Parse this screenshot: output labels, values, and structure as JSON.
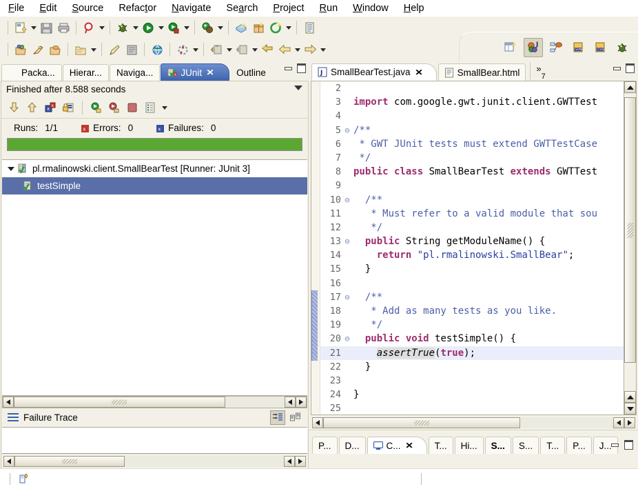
{
  "menubar": {
    "items": [
      {
        "label": "File",
        "accel": "F"
      },
      {
        "label": "Edit",
        "accel": "E"
      },
      {
        "label": "Source",
        "accel": "S"
      },
      {
        "label": "Refactor",
        "accel": "t"
      },
      {
        "label": "Navigate",
        "accel": "N"
      },
      {
        "label": "Search",
        "accel": "a"
      },
      {
        "label": "Project",
        "accel": "P"
      },
      {
        "label": "Run",
        "accel": "R"
      },
      {
        "label": "Window",
        "accel": "W"
      },
      {
        "label": "Help",
        "accel": "H"
      }
    ]
  },
  "toolbar": {
    "row1": [
      {
        "name": "new-wizard",
        "icon": "new-file-icon",
        "dropdown": true
      },
      {
        "name": "save",
        "icon": "save-icon",
        "dropdown": false
      },
      {
        "name": "print",
        "icon": "print-icon",
        "dropdown": false
      },
      {
        "name": "search",
        "icon": "search-icon",
        "dropdown": true
      },
      {
        "name": "debug",
        "icon": "debug-bug-icon",
        "dropdown": true
      },
      {
        "name": "run",
        "icon": "run-play-icon",
        "dropdown": true
      },
      {
        "name": "run-external",
        "icon": "run-external-icon",
        "dropdown": true
      },
      {
        "name": "profile",
        "icon": "profile-icon",
        "dropdown": true
      },
      {
        "name": "new-gwt-module",
        "icon": "gwt-module-icon",
        "dropdown": false
      },
      {
        "name": "new-package",
        "icon": "package-icon",
        "dropdown": false
      },
      {
        "name": "gwt-compile",
        "icon": "gwt-compile-icon",
        "dropdown": true
      },
      {
        "name": "open-task",
        "icon": "task-list-icon",
        "dropdown": false
      }
    ],
    "row2": [
      {
        "name": "open-type",
        "icon": "open-type-icon",
        "dropdown": false
      },
      {
        "name": "new-java-class",
        "icon": "java-class-icon",
        "dropdown": false
      },
      {
        "name": "open-resource",
        "icon": "open-resource-icon",
        "dropdown": false
      },
      {
        "name": "new-folder",
        "icon": "new-folder-icon",
        "dropdown": true
      },
      {
        "name": "external-tools",
        "icon": "pencil-icon",
        "dropdown": false
      },
      {
        "name": "toggle-markers",
        "icon": "markers-icon",
        "dropdown": false
      },
      {
        "name": "open-browser",
        "icon": "globe-icon",
        "dropdown": false
      },
      {
        "name": "last-edit",
        "icon": "history-icon",
        "dropdown": true
      },
      {
        "name": "next-annotation",
        "icon": "next-annotation-icon",
        "dropdown": true
      },
      {
        "name": "prev-annotation",
        "icon": "prev-annotation-icon",
        "dropdown": true
      },
      {
        "name": "back-to-edit",
        "icon": "back-edit-icon",
        "dropdown": false
      },
      {
        "name": "back",
        "icon": "back-arrow-icon",
        "dropdown": true
      },
      {
        "name": "forward",
        "icon": "forward-arrow-icon",
        "dropdown": true
      }
    ]
  },
  "perspectives": [
    {
      "name": "open-perspective",
      "icon": "open-perspective-icon",
      "active": false
    },
    {
      "name": "java-perspective",
      "icon": "java-perspective-icon",
      "active": true
    },
    {
      "name": "java-browsing-perspective",
      "icon": "java-browsing-icon",
      "active": false
    },
    {
      "name": "svn-perspective",
      "icon": "svn-repo-icon",
      "active": false
    },
    {
      "name": "cvs-perspective",
      "icon": "cvs-repo-icon",
      "active": false
    },
    {
      "name": "debug-perspective",
      "icon": "debug-perspective-icon",
      "active": false
    }
  ],
  "left_view": {
    "tabs": [
      {
        "label": "Packa...",
        "icon": "package-explorer-icon",
        "active": false,
        "closeable": false
      },
      {
        "label": "Hierar...",
        "icon": "hierarchy-icon",
        "active": false,
        "closeable": false
      },
      {
        "label": "Naviga...",
        "icon": "navigator-icon",
        "active": false,
        "closeable": false
      },
      {
        "label": "JUnit",
        "icon": "junit-icon",
        "active": true,
        "closeable": true
      },
      {
        "label": "Outline",
        "icon": "outline-icon",
        "active": false,
        "closeable": false
      }
    ],
    "minimize_label": "Minimize",
    "maximize_label": "Maximize",
    "junit": {
      "status": "Finished after 8.588 seconds",
      "toolbar": [
        {
          "name": "next-failure",
          "icon": "arrow-down-icon"
        },
        {
          "name": "previous-failure",
          "icon": "arrow-up-icon"
        },
        {
          "name": "show-failures-only",
          "icon": "failures-only-icon"
        },
        {
          "name": "lock-scroll",
          "icon": "lock-icon"
        },
        {
          "name": "rerun-test",
          "icon": "rerun-icon"
        },
        {
          "name": "rerun-failed-tests",
          "icon": "rerun-failed-icon"
        },
        {
          "name": "stop-test-run",
          "icon": "stop-icon"
        },
        {
          "name": "test-run-history",
          "icon": "history-list-icon"
        }
      ],
      "counters": {
        "runs_label": "Runs:",
        "runs_value": "1/1",
        "errors_label": "Errors:",
        "errors_value": "0",
        "failures_label": "Failures:",
        "failures_value": "0"
      },
      "progress": {
        "percent": 100,
        "color": "#5aa832"
      },
      "tree": [
        {
          "label": "pl.rmalinowski.client.SmallBearTest [Runner: JUnit 3]",
          "icon": "test-suite-icon",
          "expanded": true,
          "selected": false,
          "indent": 0
        },
        {
          "label": "testSimple",
          "icon": "test-method-icon",
          "expanded": false,
          "selected": true,
          "indent": 1
        }
      ],
      "failure_trace": {
        "title": "Failure Trace",
        "icon": "stack-trace-icon",
        "buttons": [
          {
            "name": "filter-stack-trace",
            "icon": "filter-icon",
            "pressed": true
          },
          {
            "name": "compare-result",
            "icon": "compare-icon",
            "pressed": false
          }
        ],
        "content": ""
      }
    }
  },
  "editor": {
    "tabs": [
      {
        "label": "SmallBearTest.java",
        "icon": "java-file-icon",
        "active": true,
        "closeable": true
      },
      {
        "label": "SmallBear.html",
        "icon": "html-file-icon",
        "active": false,
        "closeable": false
      }
    ],
    "overflow_label": "»",
    "overflow_count": "7",
    "minimize_label": "Minimize",
    "maximize_label": "Maximize",
    "code_lines": [
      {
        "num": "2",
        "fold": "",
        "marker": "",
        "tokens": [],
        "highlight": false,
        "changed": false
      },
      {
        "num": "3",
        "fold": "",
        "marker": "",
        "highlight": false,
        "changed": false,
        "tokens": [
          {
            "t": "import ",
            "c": "kw"
          },
          {
            "t": "com.google.gwt.junit.client.GWTTest",
            "c": "plain"
          }
        ]
      },
      {
        "num": "4",
        "fold": "",
        "marker": "",
        "tokens": [],
        "highlight": false,
        "changed": false
      },
      {
        "num": "5",
        "fold": "⊖",
        "marker": "",
        "highlight": false,
        "changed": false,
        "tokens": [
          {
            "t": "/**",
            "c": "cmt"
          }
        ]
      },
      {
        "num": "6",
        "fold": "",
        "marker": "",
        "highlight": false,
        "changed": false,
        "tokens": [
          {
            "t": " * GWT JUnit tests must extend GWTTestCase",
            "c": "cmt"
          }
        ]
      },
      {
        "num": "7",
        "fold": "",
        "marker": "",
        "highlight": false,
        "changed": false,
        "tokens": [
          {
            "t": " */",
            "c": "cmt"
          }
        ]
      },
      {
        "num": "8",
        "fold": "",
        "marker": "",
        "highlight": false,
        "changed": false,
        "tokens": [
          {
            "t": "public class ",
            "c": "kw"
          },
          {
            "t": "SmallBearTest ",
            "c": "plain"
          },
          {
            "t": "extends ",
            "c": "kw"
          },
          {
            "t": "GWTTest",
            "c": "plain"
          }
        ]
      },
      {
        "num": "9",
        "fold": "",
        "marker": "",
        "tokens": [],
        "highlight": false,
        "changed": false
      },
      {
        "num": "10",
        "fold": "⊖",
        "marker": "",
        "highlight": false,
        "changed": false,
        "tokens": [
          {
            "t": "  /**",
            "c": "cmt"
          }
        ]
      },
      {
        "num": "11",
        "fold": "",
        "marker": "",
        "highlight": false,
        "changed": false,
        "tokens": [
          {
            "t": "   * Must refer to a valid module that sou",
            "c": "cmt"
          }
        ]
      },
      {
        "num": "12",
        "fold": "",
        "marker": "",
        "highlight": false,
        "changed": false,
        "tokens": [
          {
            "t": "   */",
            "c": "cmt"
          }
        ]
      },
      {
        "num": "13",
        "fold": "⊖",
        "marker": "override",
        "highlight": false,
        "changed": false,
        "tokens": [
          {
            "t": "  public ",
            "c": "kw"
          },
          {
            "t": "String getModuleName() {",
            "c": "plain"
          }
        ]
      },
      {
        "num": "14",
        "fold": "",
        "marker": "",
        "highlight": false,
        "changed": false,
        "tokens": [
          {
            "t": "    ",
            "c": "plain"
          },
          {
            "t": "return ",
            "c": "kw"
          },
          {
            "t": "\"pl.rmalinowski.SmallBear\"",
            "c": "str"
          },
          {
            "t": ";",
            "c": "plain"
          }
        ]
      },
      {
        "num": "15",
        "fold": "",
        "marker": "",
        "highlight": false,
        "changed": false,
        "tokens": [
          {
            "t": "  }",
            "c": "plain"
          }
        ]
      },
      {
        "num": "16",
        "fold": "",
        "marker": "",
        "tokens": [],
        "highlight": false,
        "changed": false
      },
      {
        "num": "17",
        "fold": "⊖",
        "marker": "",
        "highlight": false,
        "changed": true,
        "tokens": [
          {
            "t": "  /**",
            "c": "cmt"
          }
        ]
      },
      {
        "num": "18",
        "fold": "",
        "marker": "",
        "highlight": false,
        "changed": true,
        "tokens": [
          {
            "t": "   * Add as many tests as you like.",
            "c": "cmt"
          }
        ]
      },
      {
        "num": "19",
        "fold": "",
        "marker": "",
        "highlight": false,
        "changed": true,
        "tokens": [
          {
            "t": "   */",
            "c": "cmt"
          }
        ]
      },
      {
        "num": "20",
        "fold": "⊖",
        "marker": "",
        "highlight": false,
        "changed": true,
        "tokens": [
          {
            "t": "  public void ",
            "c": "kw"
          },
          {
            "t": "testSimple() {",
            "c": "plain"
          }
        ]
      },
      {
        "num": "21",
        "fold": "",
        "marker": "",
        "highlight": true,
        "changed": true,
        "tokens": [
          {
            "t": "    ",
            "c": "plain"
          },
          {
            "t": "assertTrue",
            "c": "stat"
          },
          {
            "t": "(",
            "c": "plain"
          },
          {
            "t": "true",
            "c": "kw"
          },
          {
            "t": ");",
            "c": "plain"
          }
        ]
      },
      {
        "num": "22",
        "fold": "",
        "marker": "",
        "highlight": false,
        "changed": true,
        "tokens": [
          {
            "t": "  }",
            "c": "plain"
          }
        ]
      },
      {
        "num": "23",
        "fold": "",
        "marker": "",
        "tokens": [],
        "highlight": false,
        "changed": false
      },
      {
        "num": "24",
        "fold": "",
        "marker": "",
        "highlight": false,
        "changed": false,
        "tokens": [
          {
            "t": "}",
            "c": "plain"
          }
        ]
      },
      {
        "num": "25",
        "fold": "",
        "marker": "",
        "tokens": [],
        "highlight": false,
        "changed": false
      }
    ]
  },
  "bottom_tabs": [
    {
      "label": "P...",
      "icon": "",
      "active": false,
      "bold": false
    },
    {
      "label": "D...",
      "icon": "",
      "active": false,
      "bold": false
    },
    {
      "label": "C...",
      "icon": "console-icon",
      "active": true,
      "bold": false,
      "closeable": true
    },
    {
      "label": "T...",
      "icon": "",
      "active": false,
      "bold": false
    },
    {
      "label": "Hi...",
      "icon": "",
      "active": false,
      "bold": false
    },
    {
      "label": "S...",
      "icon": "",
      "active": false,
      "bold": true
    },
    {
      "label": "S...",
      "icon": "",
      "active": false,
      "bold": false
    },
    {
      "label": "T...",
      "icon": "",
      "active": false,
      "bold": false
    },
    {
      "label": "P...",
      "icon": "",
      "active": false,
      "bold": false
    },
    {
      "label": "J...",
      "icon": "",
      "active": false,
      "bold": false
    }
  ],
  "statusbar": {
    "icon": "writable-indicator-icon",
    "text": ""
  },
  "colors": {
    "accent_tab": "#3f63ad",
    "toolbar_bg": "#f3f1e7",
    "progress_green": "#5aa832",
    "selection_blue": "#5a6ea8",
    "keyword": "#9c2d6d",
    "comment": "#4c5fa8",
    "string": "#2a3fa0"
  }
}
